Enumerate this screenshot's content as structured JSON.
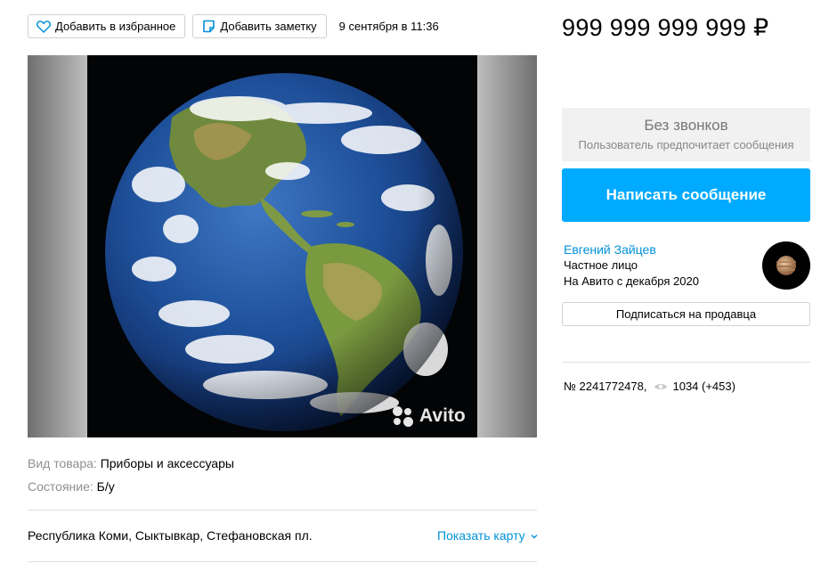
{
  "actions": {
    "favorite_label": "Добавить в избранное",
    "note_label": "Добавить заметку",
    "date": "9 сентября в 11:36"
  },
  "photo": {
    "watermark": "Avito"
  },
  "params": [
    {
      "key": "Вид товара:",
      "value": "Приборы и аксессуары"
    },
    {
      "key": "Состояние:",
      "value": "Б/у"
    }
  ],
  "location": {
    "address": "Республика Коми, Сыктывкар, Стефановская пл.",
    "map_link": "Показать карту"
  },
  "price": "999 999 999 999 ₽",
  "contact": {
    "no_calls_title": "Без звонков",
    "no_calls_subtitle": "Пользователь предпочитает сообщения",
    "message_button": "Написать сообщение"
  },
  "seller": {
    "name": "Евгений Зайцев",
    "type": "Частное лицо",
    "since": "На Авито с декабря 2020",
    "subscribe_label": "Подписаться на продавца"
  },
  "listing": {
    "number": "№ 2241772478,",
    "views": "1034 (+453)"
  },
  "colors": {
    "accent": "#00aaff",
    "link": "#0091d9"
  },
  "icons": [
    "heart-icon",
    "note-icon",
    "eye-icon",
    "chevron-down-icon"
  ]
}
